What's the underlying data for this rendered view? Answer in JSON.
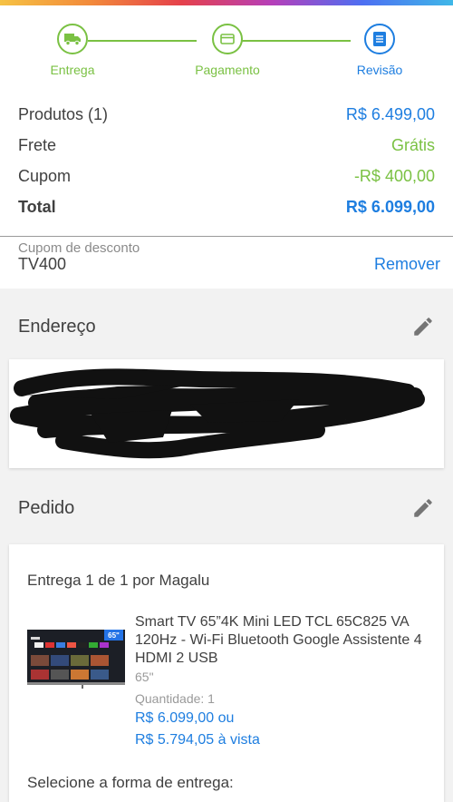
{
  "colors": {
    "accent_green": "#7ac143",
    "accent_blue": "#1e7ee0",
    "text": "#404040"
  },
  "stepper": {
    "steps": [
      {
        "label": "Entrega",
        "icon": "truck-icon",
        "state": "done"
      },
      {
        "label": "Pagamento",
        "icon": "credit-card-icon",
        "state": "done"
      },
      {
        "label": "Revisão",
        "icon": "document-icon",
        "state": "active"
      }
    ]
  },
  "summary": {
    "products_label": "Produtos (1)",
    "products_value": "R$ 6.499,00",
    "shipping_label": "Frete",
    "shipping_value": "Grátis",
    "coupon_label": "Cupom",
    "coupon_value": "-R$ 400,00",
    "total_label": "Total",
    "total_value": "R$ 6.099,00"
  },
  "coupon": {
    "caption": "Cupom de desconto",
    "code": "TV400",
    "remove_label": "Remover"
  },
  "address": {
    "title": "Endereço"
  },
  "order": {
    "title": "Pedido",
    "shipment": "Entrega 1 de 1 por Magalu",
    "product_name": "Smart TV 65”4K Mini LED TCL 65C825 VA 120Hz - Wi-Fi Bluetooth Google Assistente 4 HDMI 2 USB",
    "product_size": "65\"",
    "quantity": "Quantidade:  1",
    "price_installment": "R$ 6.099,00 ou",
    "price_cash": "R$ 5.794,05 à vista",
    "thumb_badge": "65\"",
    "delivery_prompt": "Selecione a forma de entrega:"
  }
}
